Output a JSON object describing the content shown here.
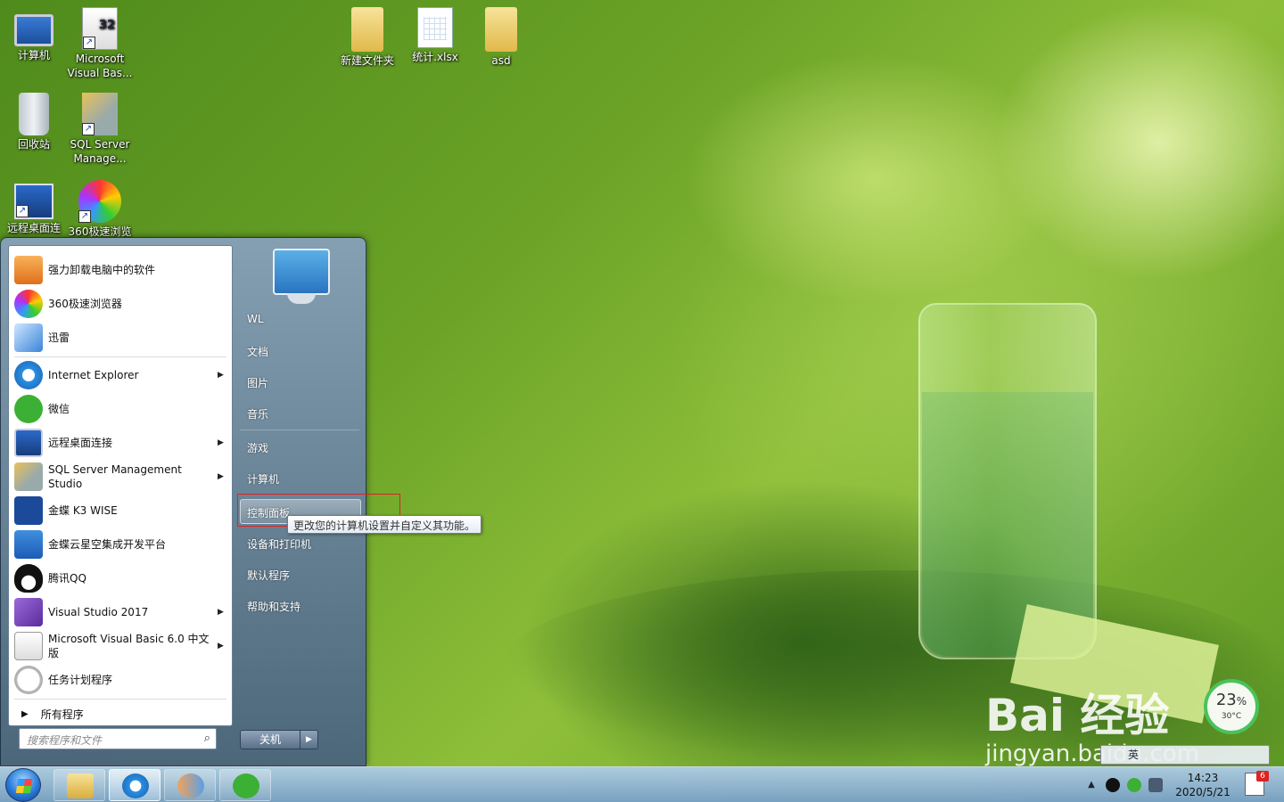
{
  "desktop": {
    "icons": [
      {
        "label": "计算机",
        "icon": "computer-icon"
      },
      {
        "label": "Microsoft Visual Bas...",
        "icon": "vb6-icon",
        "badge": "32"
      },
      {
        "label": "回收站",
        "icon": "recycle-bin-icon"
      },
      {
        "label": "SQL Server Manage...",
        "icon": "sql-server-icon"
      },
      {
        "label": "远程桌面连",
        "icon": "remote-desktop-icon"
      },
      {
        "label": "360极速浏览",
        "icon": "browser-360-icon"
      },
      {
        "label": "新建文件夹",
        "icon": "folder-icon"
      },
      {
        "label": "统计.xlsx",
        "icon": "excel-file-icon"
      },
      {
        "label": "asd",
        "icon": "folder-icon"
      }
    ]
  },
  "start_menu": {
    "programs": [
      {
        "label": "强力卸载电脑中的软件",
        "icon": "uninstall-icon",
        "submenu": false
      },
      {
        "label": "360极速浏览器",
        "icon": "browser-360-icon",
        "submenu": false
      },
      {
        "label": "迅雷",
        "icon": "thunder-icon",
        "submenu": false
      },
      {
        "label": "Internet Explorer",
        "icon": "ie-icon",
        "submenu": true
      },
      {
        "label": "微信",
        "icon": "wechat-icon",
        "submenu": false
      },
      {
        "label": "远程桌面连接",
        "icon": "remote-desktop-icon",
        "submenu": true
      },
      {
        "label": "SQL Server Management Studio",
        "icon": "sql-server-icon",
        "submenu": true
      },
      {
        "label": "金蝶 K3 WISE",
        "icon": "k3-icon",
        "submenu": false
      },
      {
        "label": "金蝶云星空集成开发平台",
        "icon": "kingdee-cloud-icon",
        "submenu": false
      },
      {
        "label": "腾讯QQ",
        "icon": "qq-icon",
        "submenu": false
      },
      {
        "label": "Visual Studio 2017",
        "icon": "visual-studio-icon",
        "submenu": true
      },
      {
        "label": "Microsoft Visual Basic 6.0 中文版",
        "icon": "vb6-icon",
        "submenu": true
      },
      {
        "label": "任务计划程序",
        "icon": "task-scheduler-icon",
        "submenu": false
      }
    ],
    "submenu_arrow": "▶",
    "all_programs": "所有程序",
    "search_placeholder": "搜索程序和文件",
    "right_items": [
      "WL",
      "文档",
      "图片",
      "音乐",
      "游戏",
      "计算机",
      "控制面板",
      "设备和打印机",
      "默认程序",
      "帮助和支持"
    ],
    "hovered_item": "控制面板",
    "tooltip": "更改您的计算机设置并自定义其功能。",
    "shutdown_label": "关机",
    "shutdown_arrow": "▶"
  },
  "taskbar": {
    "pinned": [
      "explorer-icon",
      "ie-icon",
      "users-icon",
      "wechat-icon"
    ],
    "active": "ie-icon",
    "clock_time": "14:23",
    "clock_date": "2020/5/21",
    "notification_badge": "6",
    "tray_icons": [
      "show-hidden-icon",
      "qq-icon",
      "wechat-icon",
      "network-icon"
    ]
  },
  "widgets": {
    "cpu_percent": "23",
    "cpu_unit": "%",
    "temperature": "30°C",
    "ime_label": "英"
  },
  "watermark": {
    "main": "Bai 经验",
    "sub": "jingyan.baidu.com"
  },
  "colors": {
    "accent_red": "#dd2222",
    "taskbar": "#9cc0e0",
    "gauge_green": "#49c35a"
  }
}
